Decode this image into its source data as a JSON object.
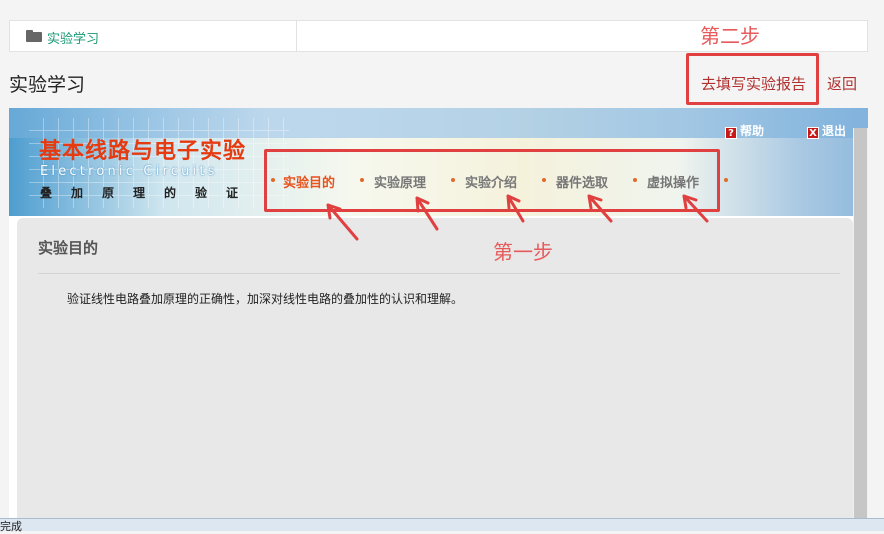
{
  "breadcrumb": {
    "icon": "folder-icon",
    "label": "实验学习"
  },
  "annotations": {
    "step2": "第二步",
    "step1": "第一步",
    "color": "#e14040"
  },
  "header": {
    "title": "实验学习",
    "report_link": "去填写实验报告",
    "back_link": "返回"
  },
  "banner": {
    "title": "基本线路与电子实验",
    "subtitle_en": "Electronic Circuits",
    "subtitle_cn": "叠加原理的验证",
    "help": "帮助",
    "exit": "退出",
    "help_icon": "?",
    "exit_icon": "X"
  },
  "nav": {
    "items": [
      {
        "label": "实验目的",
        "active": true
      },
      {
        "label": "实验原理"
      },
      {
        "label": "实验介绍"
      },
      {
        "label": "器件选取"
      },
      {
        "label": "虚拟操作"
      }
    ]
  },
  "content": {
    "title": "实验目的",
    "text": "验证线性电路叠加原理的正确性，加深对线性电路的叠加性的认识和理解。"
  },
  "status": {
    "text": "完成"
  }
}
